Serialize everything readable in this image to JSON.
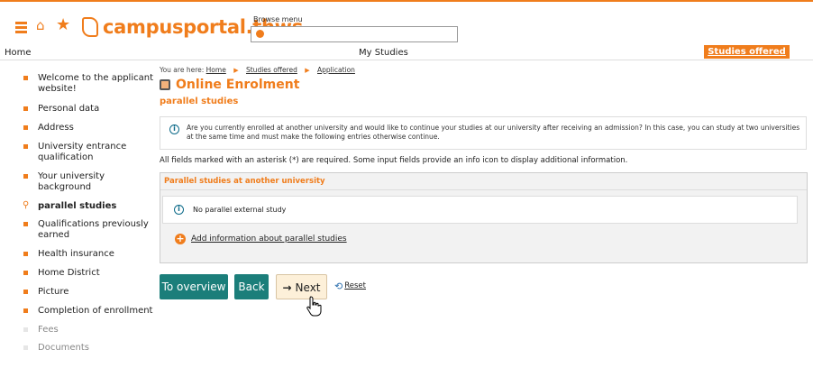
{
  "header": {
    "logo_text": "campusportal.thws",
    "browse_label": "Browse menu",
    "icons": [
      "menu-icon",
      "home-icon",
      "star-icon",
      "search-icon"
    ],
    "accent_color": "#f07d1c"
  },
  "nav": {
    "home": "Home",
    "my_studies": "My Studies",
    "studies_offered": "Studies offered"
  },
  "sidebar": {
    "items": [
      {
        "label": "Welcome to the applicant website!",
        "state": "normal"
      },
      {
        "label": "Personal data",
        "state": "normal"
      },
      {
        "label": "Address",
        "state": "normal"
      },
      {
        "label": "University entrance qualification",
        "state": "normal"
      },
      {
        "label": "Your university background",
        "state": "normal"
      },
      {
        "label": "parallel studies",
        "state": "active"
      },
      {
        "label": "Qualifications previously earned",
        "state": "normal"
      },
      {
        "label": "Health insurance",
        "state": "normal"
      },
      {
        "label": "Home District",
        "state": "normal"
      },
      {
        "label": "Picture",
        "state": "normal"
      },
      {
        "label": "Completion of enrollment",
        "state": "normal"
      },
      {
        "label": "Fees",
        "state": "disabled"
      },
      {
        "label": "Documents",
        "state": "disabled"
      }
    ]
  },
  "breadcrumb": {
    "prefix": "You are here:",
    "items": [
      "Home",
      "Studies offered",
      "Application"
    ]
  },
  "main": {
    "title": "Online Enrolment",
    "subtitle": "parallel studies",
    "info_text": "Are you currently enrolled at another university and would like to continue your studies at our university after receiving an admission? In this case, you can study at two universities at the same time and must make the following entries otherwise continue.",
    "required_note": "All fields marked with an asterisk (*) are required. Some input fields provide an info icon to display additional information.",
    "panel": {
      "heading": "Parallel studies at another university",
      "note": "No parallel external study",
      "add_link": "Add information about parallel studies"
    }
  },
  "buttons": {
    "overview": "To overview",
    "back": "Back",
    "next": "Next",
    "reset": "Reset"
  },
  "colors": {
    "teal": "#1b7e7a",
    "info_blue": "#0e6b8a"
  }
}
